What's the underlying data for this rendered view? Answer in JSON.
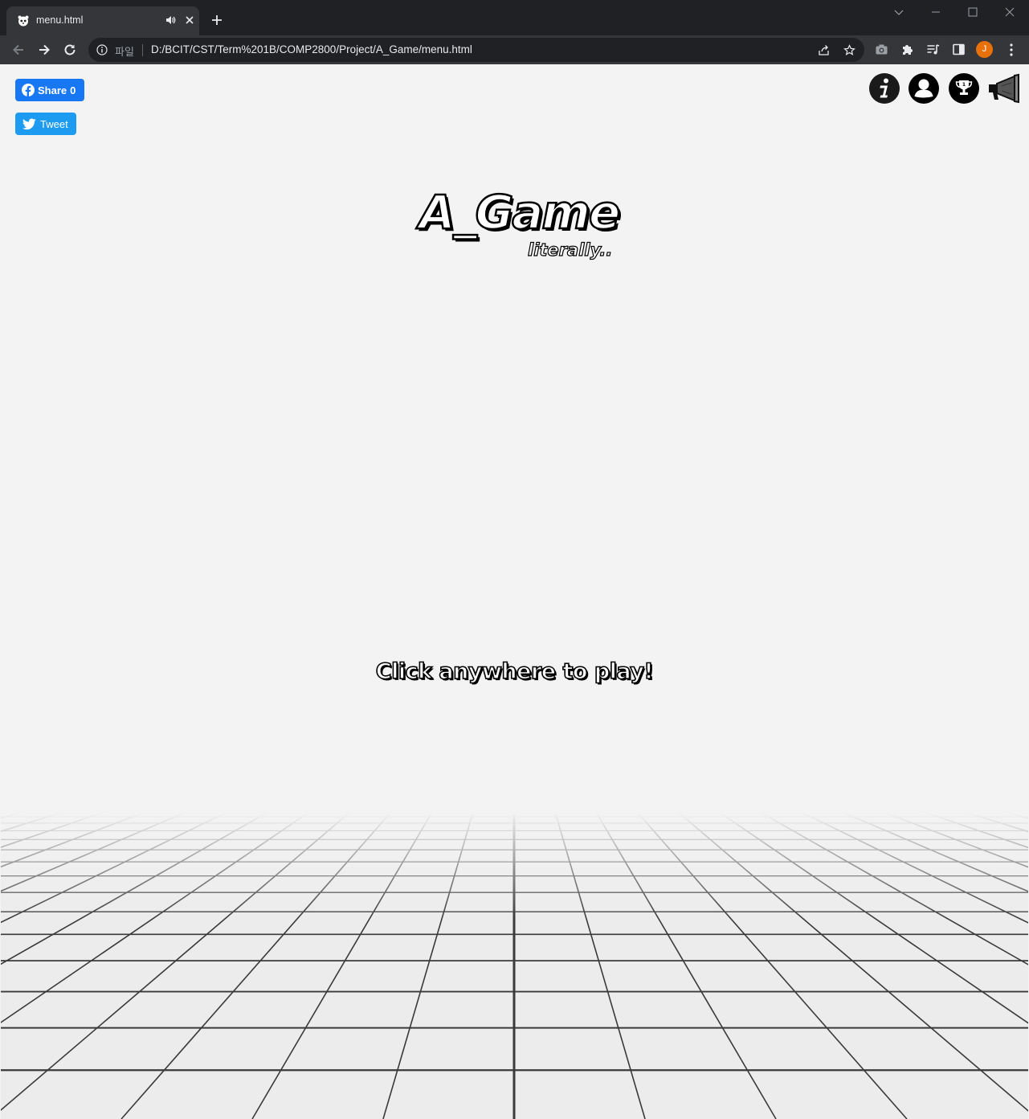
{
  "browser": {
    "tab": {
      "title": "menu.html"
    },
    "address_bar": {
      "scheme_label": "파일",
      "url": "D:/BCIT/CST/Term%201B/COMP2800/Project/A_Game/menu.html"
    },
    "profile_initial": "J"
  },
  "page": {
    "share_button": {
      "label": "Share",
      "count": "0"
    },
    "tweet_button": {
      "label": "Tweet"
    },
    "title": "A_Game",
    "subtitle": "literally..",
    "prompt": "Click anywhere to play!",
    "top_icons": [
      "info-icon",
      "user-profile-icon",
      "trophy-icon",
      "megaphone-icon"
    ]
  },
  "colors": {
    "facebook": "#1877f2",
    "twitter": "#1d9bf0",
    "page_background": "#f3f3f3",
    "profile_avatar": "#e8710a"
  }
}
